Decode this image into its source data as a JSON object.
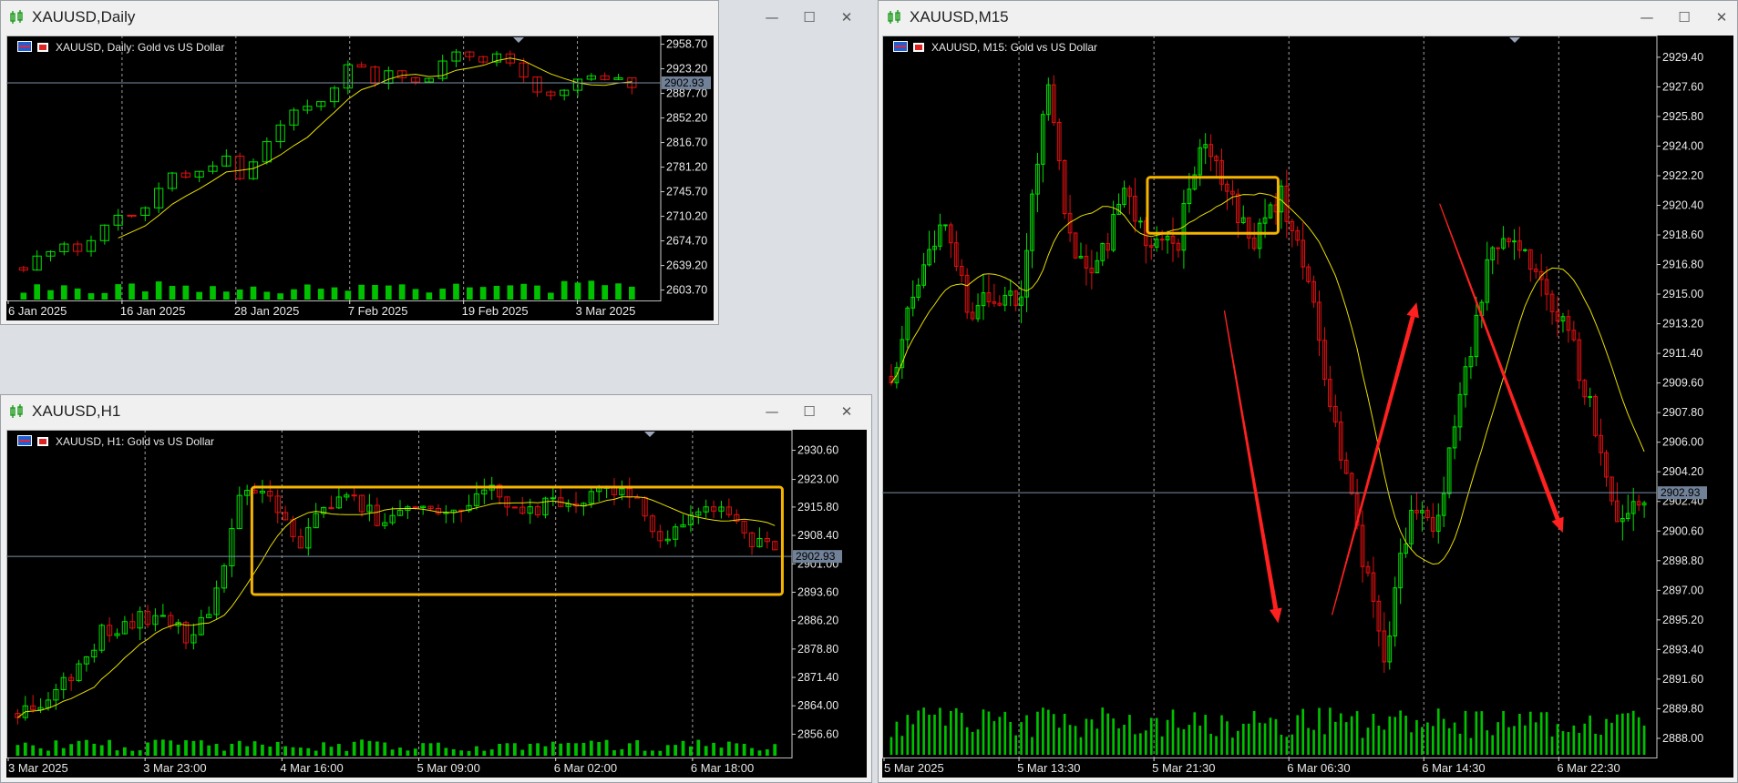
{
  "panes": {
    "daily": {
      "window_title": "XAUUSD,Daily",
      "chart_label": "XAUUSD, Daily:  Gold vs US Dollar",
      "current_price": "2902.93",
      "controls": {
        "minimize": "—",
        "maximize": "☐",
        "close": "✕"
      }
    },
    "h1": {
      "window_title": "XAUUSD,H1",
      "chart_label": "XAUUSD, H1:  Gold vs US Dollar",
      "current_price": "2902.93",
      "controls": {
        "minimize": "—",
        "maximize": "☐",
        "close": "✕"
      }
    },
    "m15": {
      "window_title": "XAUUSD,M15",
      "chart_label": "XAUUSD, M15:  Gold vs US Dollar",
      "current_price": "2902.93",
      "controls": {
        "minimize": "—",
        "maximize": "☐",
        "close": "✕"
      }
    }
  },
  "colors": {
    "bull": "#00e000",
    "bear": "#e01010",
    "ma": "#e8e000",
    "volume": "#00c000",
    "highlight_box": "#f5b400",
    "arrow": "#ff2020",
    "grid_vertical": "#c8c8c8",
    "price_line": "#7b8fa6"
  },
  "chart_data": [
    {
      "id": "daily",
      "type": "candlestick",
      "title": "XAUUSD, Daily:  Gold vs US Dollar",
      "yticks": [
        "2958.70",
        "2923.20",
        "2887.70",
        "2852.20",
        "2816.70",
        "2781.20",
        "2745.70",
        "2710.20",
        "2674.70",
        "2639.20",
        "2603.70"
      ],
      "ylim": [
        2590,
        2966
      ],
      "xticks": [
        "6 Jan 2025",
        "16 Jan 2025",
        "28 Jan 2025",
        "7 Feb 2025",
        "19 Feb 2025",
        "3 Mar 2025"
      ],
      "current_price": 2902.93,
      "series_count": 46,
      "anchors": [
        2636,
        2655,
        2675,
        2660,
        2690,
        2715,
        2704,
        2745,
        2770,
        2765,
        2785,
        2800,
        2760,
        2815,
        2850,
        2875,
        2866,
        2905,
        2935,
        2903,
        2925,
        2896,
        2915,
        2940,
        2944,
        2934,
        2950,
        2912,
        2890,
        2880,
        2903,
        2920,
        2906,
        2902
      ],
      "ma_start": 2637,
      "ma_end": 2904,
      "ma_plateau": 0.97,
      "volatility": 11,
      "volume": [
        0.2,
        0.65
      ],
      "seed": 11
    },
    {
      "id": "h1",
      "type": "candlestick",
      "title": "XAUUSD, H1:  Gold vs US Dollar",
      "yticks": [
        "2930.60",
        "2923.00",
        "2915.80",
        "2908.40",
        "2901.00",
        "2893.60",
        "2886.20",
        "2878.80",
        "2871.40",
        "2864.00",
        "2856.60"
      ],
      "ylim": [
        2851,
        2935
      ],
      "xticks": [
        "3 Mar 2025",
        "3 Mar 23:00",
        "4 Mar 16:00",
        "5 Mar 09:00",
        "6 Mar 02:00",
        "6 Mar 18:00"
      ],
      "current_price": 2902.93,
      "series_count": 100,
      "anchors": [
        2862,
        2866,
        2873,
        2883,
        2886,
        2888,
        2882,
        2891,
        2921,
        2918,
        2906,
        2916,
        2918,
        2911,
        2918,
        2915,
        2916,
        2920,
        2913,
        2918,
        2918,
        2921,
        2919,
        2906,
        2915,
        2916,
        2908,
        2904
      ],
      "ma_start": 2856,
      "ma_end": 2909,
      "ma_plateau": 0.36,
      "volatility": 3.5,
      "volume": [
        0.15,
        0.55
      ],
      "seed": 23,
      "annotations": [
        {
          "kind": "rectangle",
          "x_range": [
            0.31,
            0.99
          ],
          "y_range": [
            2893,
            2921
          ]
        }
      ]
    },
    {
      "id": "m15",
      "type": "candlestick",
      "title": "XAUUSD, M15:  Gold vs US Dollar",
      "yticks": [
        "2929.40",
        "2927.60",
        "2925.80",
        "2924.00",
        "2922.20",
        "2920.40",
        "2918.60",
        "2916.80",
        "2915.00",
        "2913.20",
        "2911.40",
        "2909.60",
        "2907.80",
        "2906.00",
        "2904.20",
        "2902.40",
        "2900.60",
        "2898.80",
        "2897.00",
        "2895.20",
        "2893.40",
        "2891.60",
        "2889.80",
        "2888.00"
      ],
      "ylim": [
        2887.0,
        2930.5
      ],
      "xticks": [
        "5 Mar 2025",
        "5 Mar 13:30",
        "5 Mar 21:30",
        "6 Mar 06:30",
        "6 Mar 14:30",
        "6 Mar 22:30"
      ],
      "current_price": 2902.93,
      "series_count": 140,
      "anchors": [
        2910,
        2916,
        2920,
        2914,
        2915,
        2915,
        2928,
        2917,
        2917,
        2921,
        2918,
        2918,
        2925,
        2921,
        2918,
        2921,
        2916,
        2908,
        2900,
        2893,
        2902,
        2901,
        2909,
        2917,
        2919,
        2916,
        2913,
        2908,
        2901,
        2903
      ],
      "ma_start": 2910,
      "ma_end": 2909,
      "ma_plateau": 0.0,
      "volatility": 1.3,
      "volume": [
        0.35,
        1.0
      ],
      "seed": 37,
      "annotations": [
        {
          "kind": "rectangle",
          "x_range": [
            0.34,
            0.51
          ],
          "y_range": [
            2918.7,
            2922.1
          ]
        },
        {
          "kind": "arrow",
          "from": [
            0.44,
            2914.0
          ],
          "to": [
            0.51,
            2895.0
          ]
        },
        {
          "kind": "arrow",
          "from": [
            0.58,
            2895.5
          ],
          "to": [
            0.69,
            2914.5
          ]
        },
        {
          "kind": "arrow",
          "from": [
            0.72,
            2920.5
          ],
          "to": [
            0.88,
            2900.5
          ]
        }
      ]
    }
  ]
}
